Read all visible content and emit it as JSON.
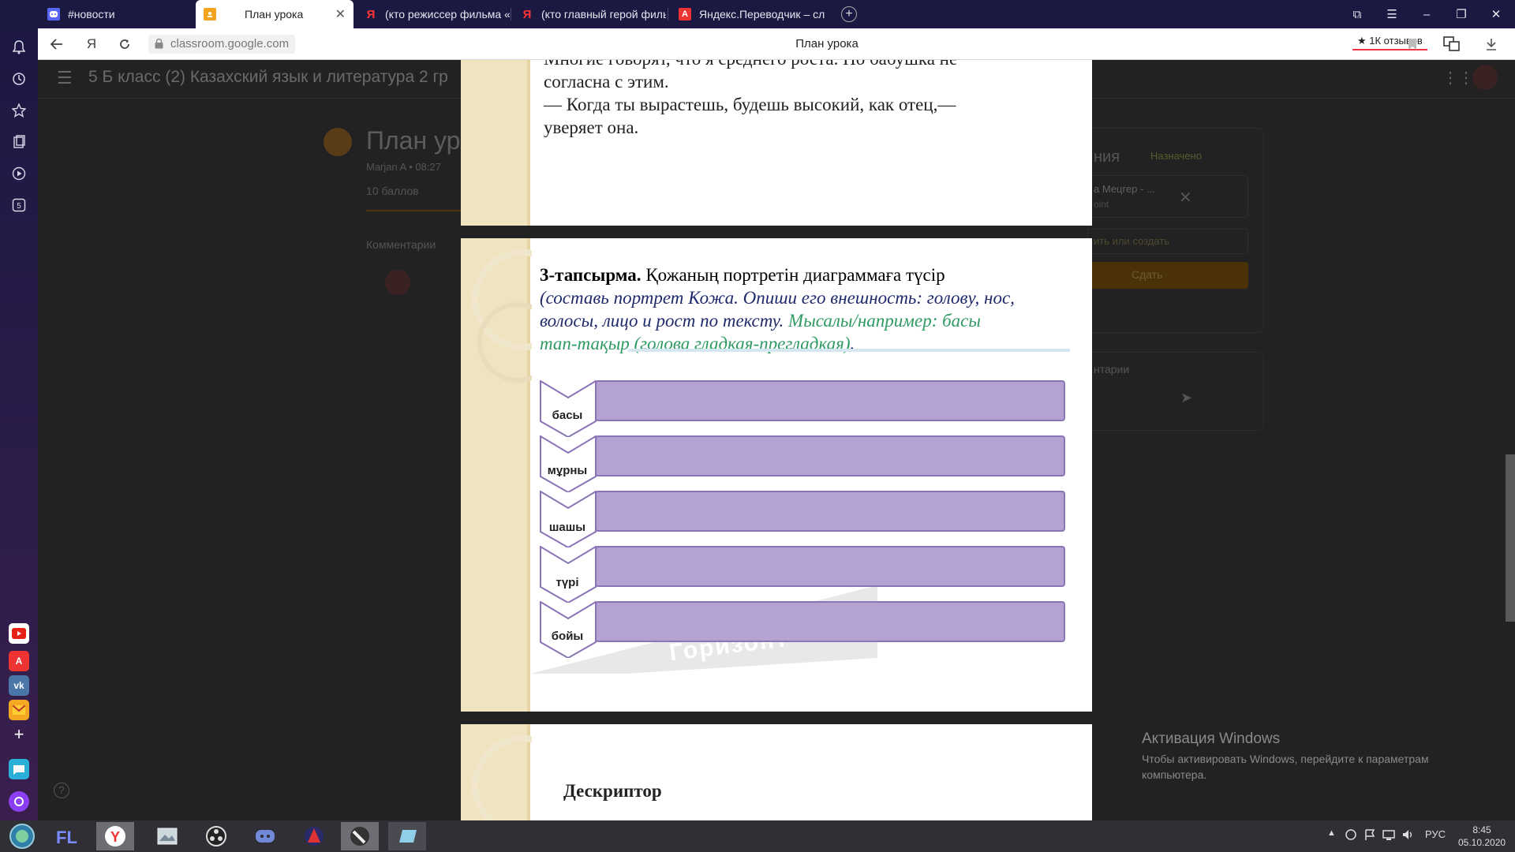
{
  "browser": {
    "tabs": [
      {
        "label": "#новости",
        "icon": "discord-icon"
      },
      {
        "label": "План урока",
        "icon": "classroom-icon",
        "active": true
      },
      {
        "label": "(кто режиссер фильма «М",
        "icon": "yandex-icon"
      },
      {
        "label": "(кто главный герой фильм",
        "icon": "yandex-icon"
      },
      {
        "label": "Яндекс.Переводчик – сло",
        "icon": "translate-icon"
      }
    ],
    "url": "classroom.google.com",
    "page_title": "План урока",
    "reviews": "★ 1К отзывов"
  },
  "classroom": {
    "class_name": "5 Б класс (2) Казахский язык и литература 2 гр",
    "post_title": "План ур",
    "post_meta": "Marjan A • 08:27",
    "points": "10 баллов",
    "comments_heading": "Комментарии",
    "work_heading": "ния",
    "status": "Назначено",
    "attachment_title": "а Мецгер - ...",
    "attachment_type": "oint",
    "add_create": "ить или создать",
    "submit": "Сдать",
    "private_comments": "нтарии"
  },
  "slide1": {
    "line1": "Многие говорят, что я среднего роста. Но бабушка не",
    "line2": "согласна с этим.",
    "line3": "— Когда ты вырастешь, будешь высокий, как отец,—",
    "line4": "уверяет она."
  },
  "slide2": {
    "task_bold": "3-тапсырма.",
    "task_text": " Қожаның портретін диаграммаға түсір",
    "ru_line1": "(составь портрет Кожа. Опиши его внешность: голову, нос,",
    "ru_line2a": "волосы, лицо и рост по тексту. ",
    "example_line2": "Мысалы/например: басы",
    "example_line3": "тап-тақыр (голова гладкая-прегладкая)",
    "ru_line3_end": ".",
    "watermark": "Горизонт",
    "rows": [
      "басы",
      "мұрны",
      "шашы",
      "түрі",
      "бойы"
    ],
    "colors": {
      "bar": "#b3a2d2",
      "bar_border": "#8a74b6",
      "example": "#2e9a62",
      "ru_text": "#1f2a6b"
    }
  },
  "slide3": {
    "heading": "Дескриптор"
  },
  "windows": {
    "activation_title": "Активация Windows",
    "activation_text1": "Чтобы активировать Windows, перейдите к параметрам",
    "activation_text2": "компьютера."
  },
  "taskbar": {
    "lang": "РУС",
    "time": "8:45",
    "date": "05.10.2020"
  }
}
